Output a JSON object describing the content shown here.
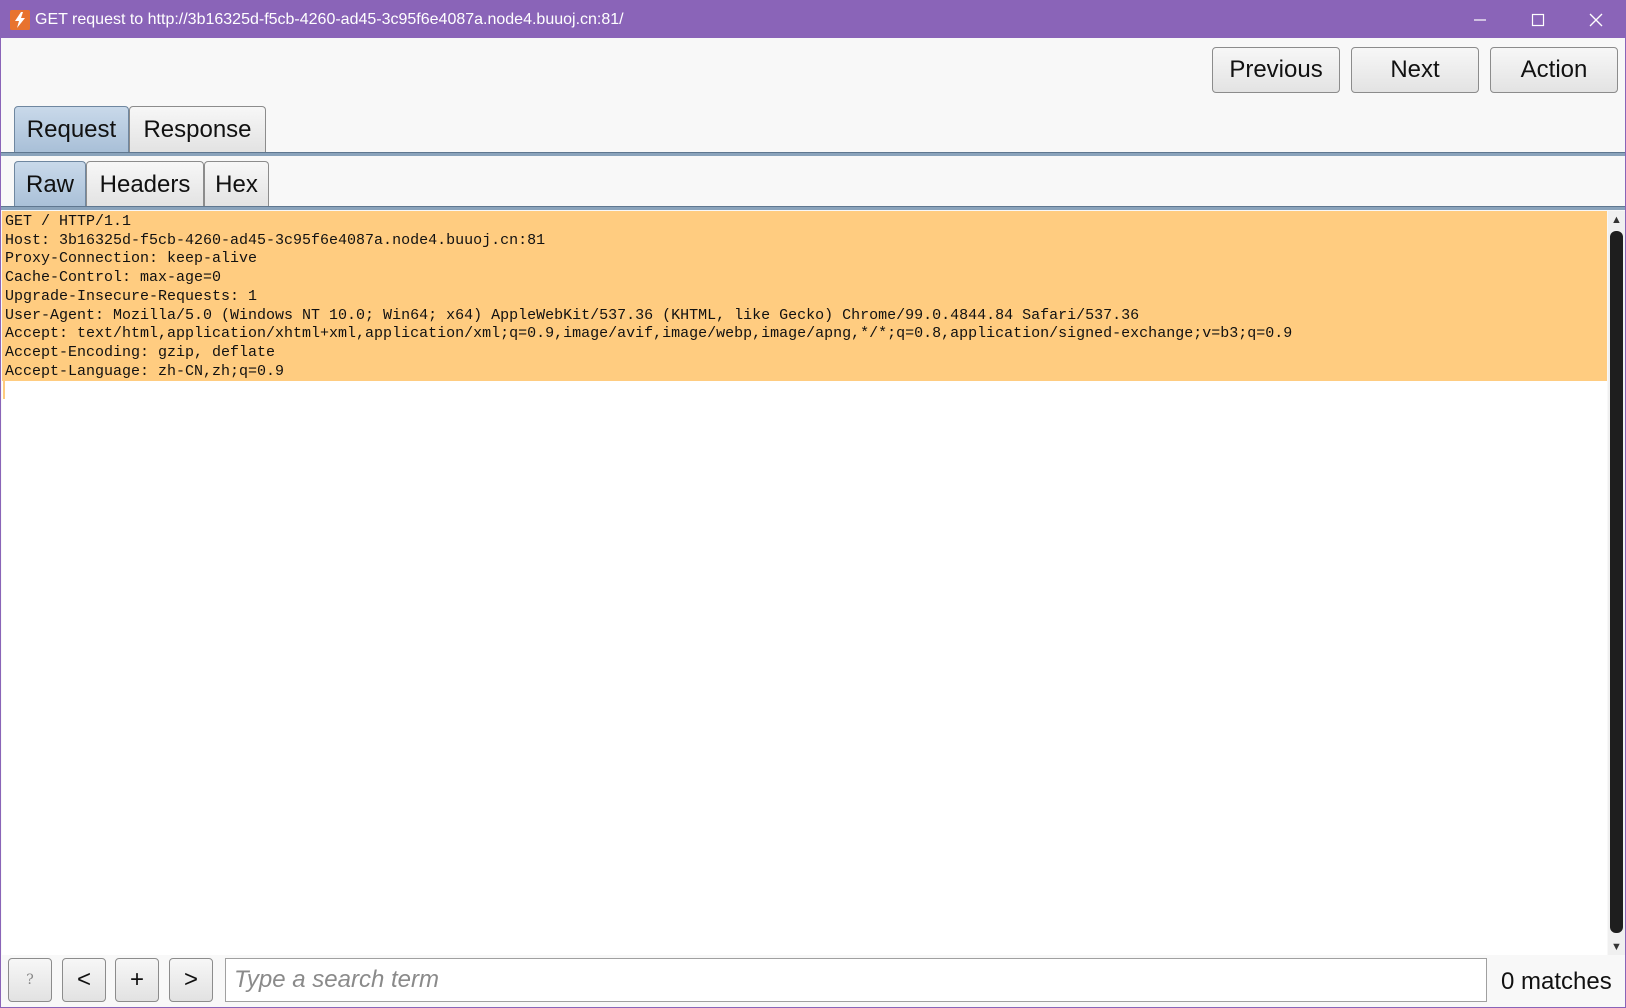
{
  "window": {
    "title": "GET request to http://3b16325d-f5cb-4260-ad45-3c95f6e4087a.node4.buuoj.cn:81/"
  },
  "toolbar": {
    "previous_label": "Previous",
    "next_label": "Next",
    "action_label": "Action"
  },
  "main_tabs": [
    {
      "label": "Request",
      "active": true
    },
    {
      "label": "Response",
      "active": false
    }
  ],
  "view_tabs": [
    {
      "label": "Raw",
      "active": true
    },
    {
      "label": "Headers",
      "active": false
    },
    {
      "label": "Hex",
      "active": false
    }
  ],
  "request": {
    "lines": [
      "GET / HTTP/1.1",
      "Host: 3b16325d-f5cb-4260-ad45-3c95f6e4087a.node4.buuoj.cn:81",
      "Proxy-Connection: keep-alive",
      "Cache-Control: max-age=0",
      "Upgrade-Insecure-Requests: 1",
      "User-Agent: Mozilla/5.0 (Windows NT 10.0; Win64; x64) AppleWebKit/537.36 (KHTML, like Gecko) Chrome/99.0.4844.84 Safari/537.36",
      "Accept: text/html,application/xhtml+xml,application/xml;q=0.9,image/avif,image/webp,image/apng,*/*;q=0.8,application/signed-exchange;v=b3;q=0.9",
      "Accept-Encoding: gzip, deflate",
      "Accept-Language: zh-CN,zh;q=0.9"
    ]
  },
  "search": {
    "help_label": "?",
    "back_label": "<",
    "add_label": "+",
    "forward_label": ">",
    "placeholder": "Type a search term",
    "value": "",
    "matches_label": "0 matches"
  },
  "colors": {
    "titlebar": "#8a64b8",
    "highlight": "#ffcc80",
    "active_tab": "#b8cce2"
  }
}
